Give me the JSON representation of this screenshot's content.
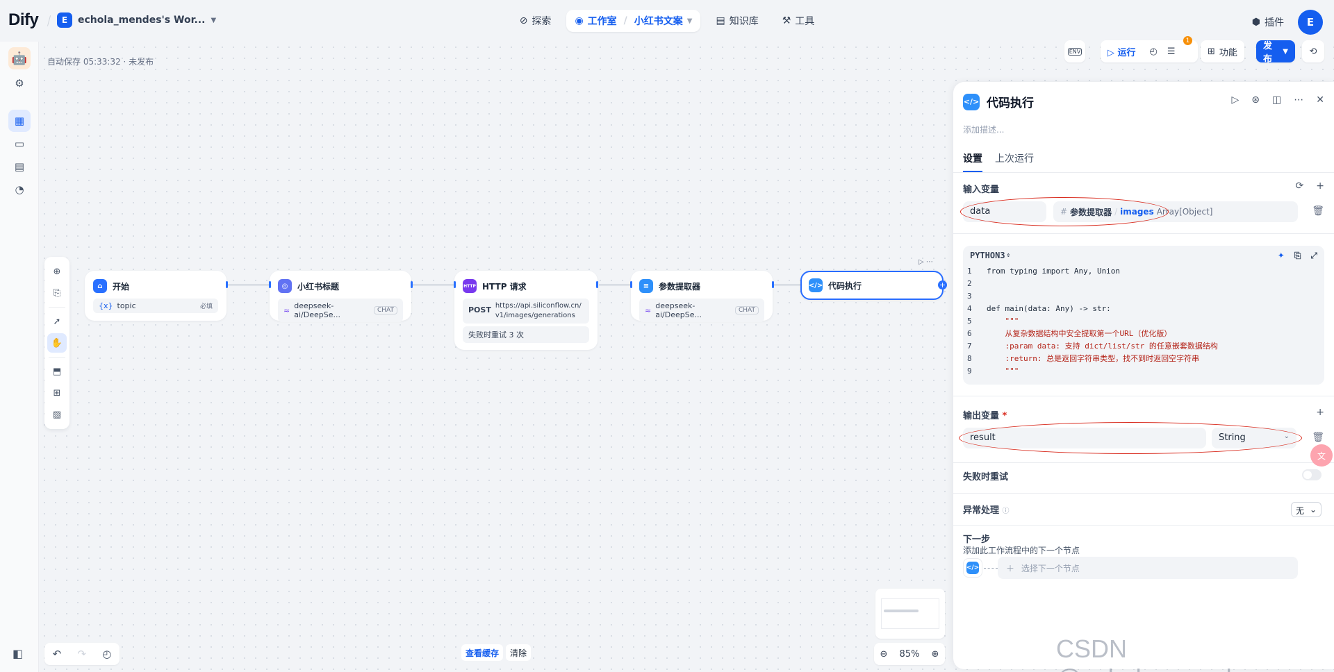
{
  "app": {
    "logo": "Dify",
    "workspace_initial": "E",
    "workspace_name": "echola_mendes's Wor..."
  },
  "nav": {
    "explore": "探索",
    "studio": "工作室",
    "current_app": "小红书文案",
    "knowledge": "知识库",
    "tools": "工具"
  },
  "header_right": {
    "plugins": "插件",
    "avatar": "E"
  },
  "canvas": {
    "autosave": "自动保存 05:33:32 · 未发布"
  },
  "toolbar": {
    "env": "ENV",
    "run": "运行",
    "badge": "1",
    "features": "功能",
    "publish": "发布"
  },
  "nodes": {
    "start": {
      "title": "开始",
      "var": "topic",
      "required": "必填"
    },
    "llm": {
      "title": "小红书标题",
      "model": "deepseek-ai/DeepSe...",
      "tag": "CHAT"
    },
    "http": {
      "title": "HTTP 请求",
      "method": "POST",
      "url": "https://api.siliconflow.cn/v1/images/generations",
      "retry": "失败时重试 3 次",
      "icon_text": "HTTP"
    },
    "param": {
      "title": "参数提取器",
      "model": "deepseek-ai/DeepSe...",
      "tag": "CHAT"
    },
    "code": {
      "title": "代码执行"
    }
  },
  "panel": {
    "title": "代码执行",
    "desc_placeholder": "添加描述...",
    "tabs": [
      "设置",
      "上次运行"
    ],
    "input_title": "输入变量",
    "input_var": {
      "name": "data",
      "source": "参数提取器",
      "field": "images",
      "type": "Array[Object]"
    },
    "code_lang": "PYTHON3",
    "code_lines": [
      {
        "n": "1",
        "t": "from typing import Any, Union"
      },
      {
        "n": "2",
        "t": ""
      },
      {
        "n": "3",
        "t": ""
      },
      {
        "n": "4",
        "t": "def main(data: Any) -> str:"
      },
      {
        "n": "5",
        "t": "    \"\"\""
      },
      {
        "n": "6",
        "t": "    从复杂数据结构中安全提取第一个URL（优化版）"
      },
      {
        "n": "7",
        "t": "    :param data: 支持 dict/list/str 的任意嵌套数据结构"
      },
      {
        "n": "8",
        "t": "    :return: 总是返回字符串类型，找不到时返回空字符串"
      },
      {
        "n": "9",
        "t": "    \"\"\""
      }
    ],
    "output_title": "输出变量",
    "output_required": "*",
    "output_var": {
      "name": "result",
      "type": "String"
    },
    "retry": "失败时重试",
    "error_handling": "异常处理",
    "error_value": "无",
    "next_title": "下一步",
    "next_sub": "添加此工作流程中的下一个节点",
    "next_placeholder": "选择下一个节点"
  },
  "bottom": {
    "view_cache": "查看缓存",
    "clear": "清除",
    "zoom": "85%"
  },
  "watermark": "CSDN @echola_mendes",
  "colors": {
    "accent": "#155eef",
    "highlight_ellipse": "#d92d20"
  }
}
